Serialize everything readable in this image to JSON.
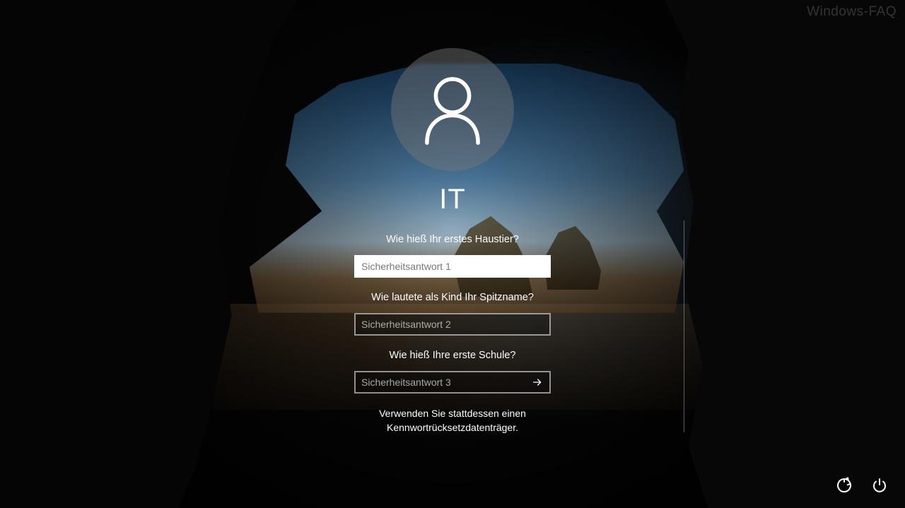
{
  "watermark": "Windows-FAQ",
  "user": {
    "name": "IT"
  },
  "questions": [
    {
      "prompt": "Wie hieß Ihr erstes Haustier?",
      "placeholder": "Sicherheitsantwort 1",
      "active": true
    },
    {
      "prompt": "Wie lautete als Kind Ihr Spitzname?",
      "placeholder": "Sicherheitsantwort 2",
      "active": false
    },
    {
      "prompt": "Wie hieß Ihre erste Schule?",
      "placeholder": "Sicherheitsantwort 3",
      "active": false
    }
  ],
  "alt_link": "Verwenden Sie stattdessen einen Kennwortrücksetzdatenträger.",
  "icons": {
    "ease_of_access": "ease-of-access-icon",
    "power": "power-icon",
    "submit": "arrow-right-icon",
    "user": "user-icon"
  }
}
